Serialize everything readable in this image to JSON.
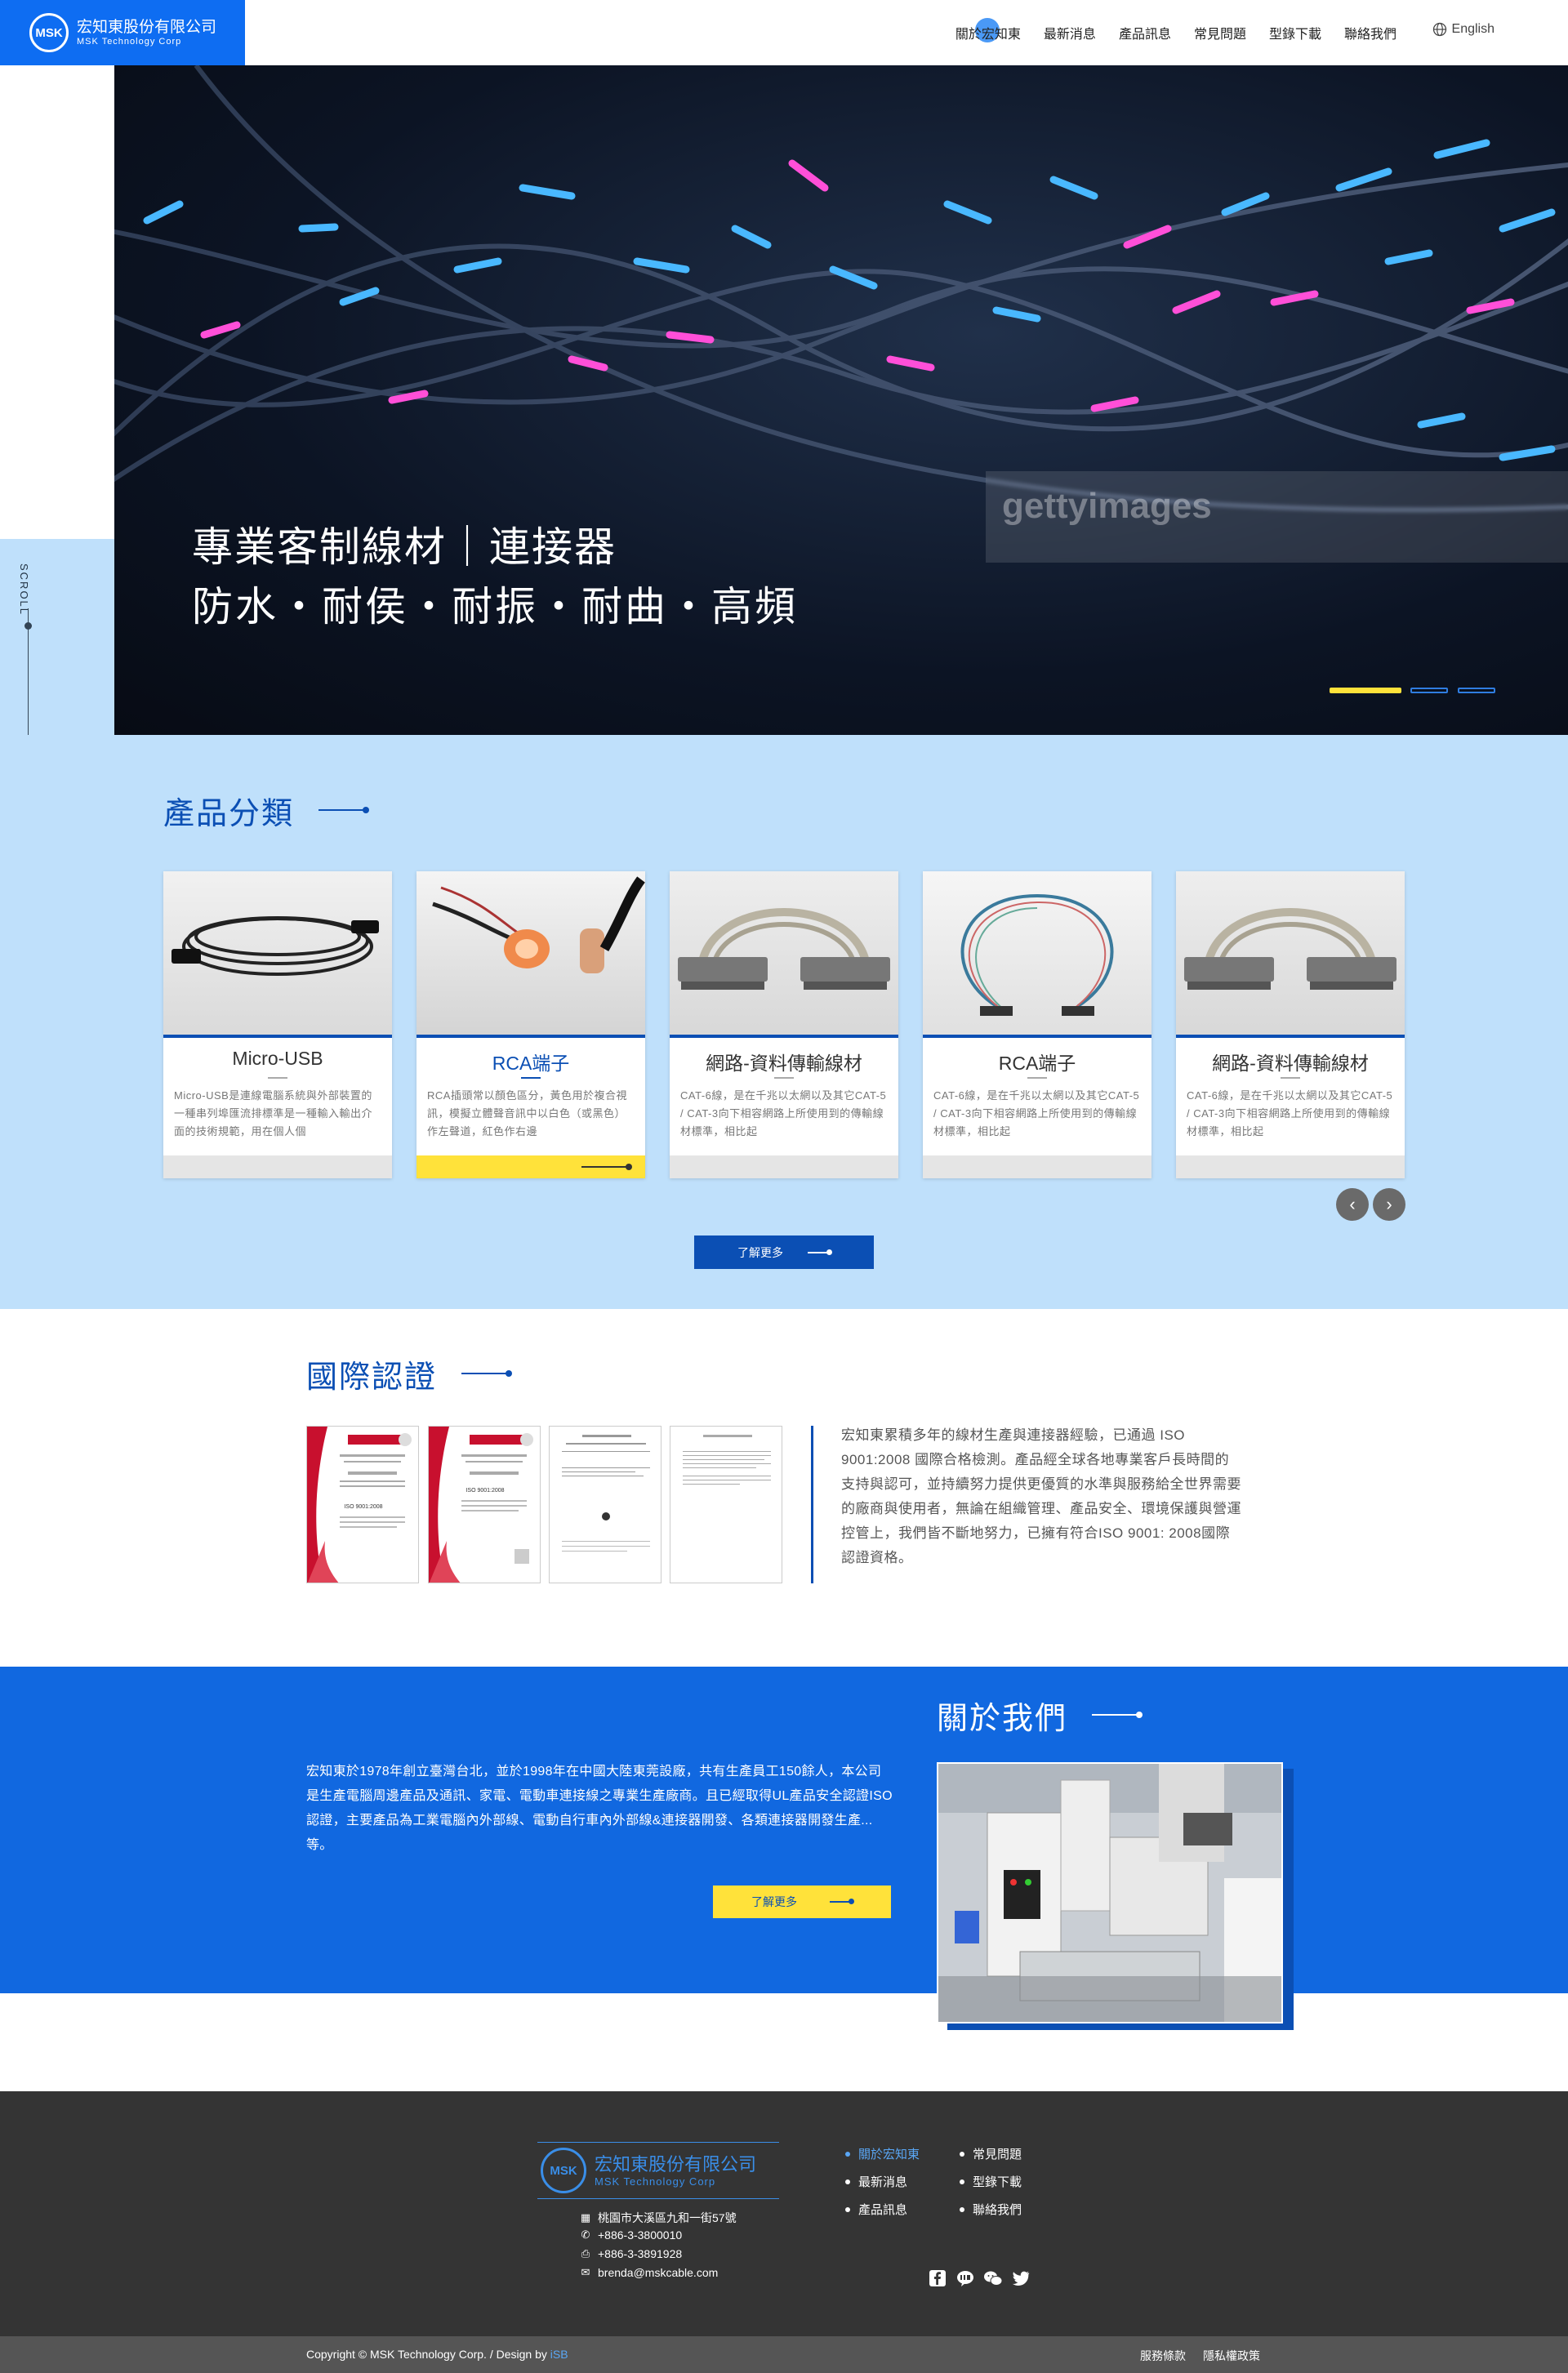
{
  "brand": {
    "name_cn": "宏知東股份有限公司",
    "name_en": "MSK Technology Corp",
    "mark": "MSK"
  },
  "nav": {
    "items": [
      "關於宏知東",
      "最新消息",
      "產品訊息",
      "常見問題",
      "型錄下載",
      "聯絡我們"
    ],
    "lang": "English"
  },
  "scroll": {
    "label": "SCROLL"
  },
  "hero": {
    "line1": "專業客制線材｜連接器",
    "line2": "防水・耐侯・耐振・耐曲・高頻",
    "watermark": "gettyimages",
    "slides": 3,
    "active_slide": 0
  },
  "products": {
    "title": "產品分類",
    "cards": [
      {
        "name": "Micro-USB",
        "desc": "Micro-USB是連線電腦系統與外部裝置的一種串列埠匯流排標準是一種輸入輸出介面的技術規範，用在個人個"
      },
      {
        "name": "RCA端子",
        "desc": "RCA插頭常以顏色區分，黃色用於複合視訊，模擬立體聲音訊中以白色（或黑色）作左聲道，紅色作右邊"
      },
      {
        "name": "網路-資料傳輸線材",
        "desc": "CAT-6線，是在千兆以太網以及其它CAT-5 / CAT-3向下相容網路上所使用到的傳輸線材標準，相比起"
      },
      {
        "name": "RCA端子",
        "desc": "CAT-6線，是在千兆以太網以及其它CAT-5 / CAT-3向下相容網路上所使用到的傳輸線材標準，相比起"
      },
      {
        "name": "網路-資料傳輸線材",
        "desc": "CAT-6線，是在千兆以太網以及其它CAT-5 / CAT-3向下相容網路上所使用到的傳輸線材標準，相比起"
      }
    ],
    "active_card": 1,
    "prev": "‹",
    "next": "›",
    "more": "了解更多"
  },
  "cert": {
    "title": "國際認證",
    "text": "宏知東累積多年的線材生產與連接器經驗，已通過 ISO 9001:2008 國際合格檢測。產品經全球各地專業客戶長時間的支持與認可，並持續努力提供更優質的水準與服務給全世界需要的廠商與使用者，無論在組織管理、產品安全、環境保護與營運控管上，我們皆不斷地努力，已擁有符合ISO 9001: 2008國際認證資格。",
    "doc_labels": [
      "ISO 9001:2008",
      "ISO 9001:2008"
    ]
  },
  "about": {
    "title": "關於我們",
    "text": "宏知東於1978年創立臺灣台北，並於1998年在中國大陸東莞設廠，共有生產員工150餘人，本公司是生產電腦周邊產品及通訊、家電、電動車連接線之專業生產廠商。且已經取得UL產品安全認證ISO認證，主要產品為工業電腦內外部線、電動自行車內外部線&連接器開發、各類連接器開發生產...等。",
    "more": "了解更多"
  },
  "footer": {
    "address": "桃園市大溪區九和一街57號",
    "phone": "+886-3-3800010",
    "fax": "+886-3-3891928",
    "email": "brenda@mskcable.com",
    "links": [
      "關於宏知東",
      "常見問題",
      "最新消息",
      "型錄下載",
      "產品訊息",
      "聯絡我們"
    ],
    "active_link": 0,
    "social": [
      "facebook-icon",
      "line-icon",
      "wechat-icon",
      "twitter-icon"
    ],
    "copyright": "Copyright © MSK Technology Corp. / Design by ",
    "designer": "iSB",
    "terms": "服務條款",
    "privacy": "隱私權政策"
  },
  "colors": {
    "primary": "#0b4fb4",
    "accent_blue": "#1168e0",
    "light_blue": "#bfe0fb",
    "yellow": "#ffe23a",
    "footer": "#343434"
  }
}
